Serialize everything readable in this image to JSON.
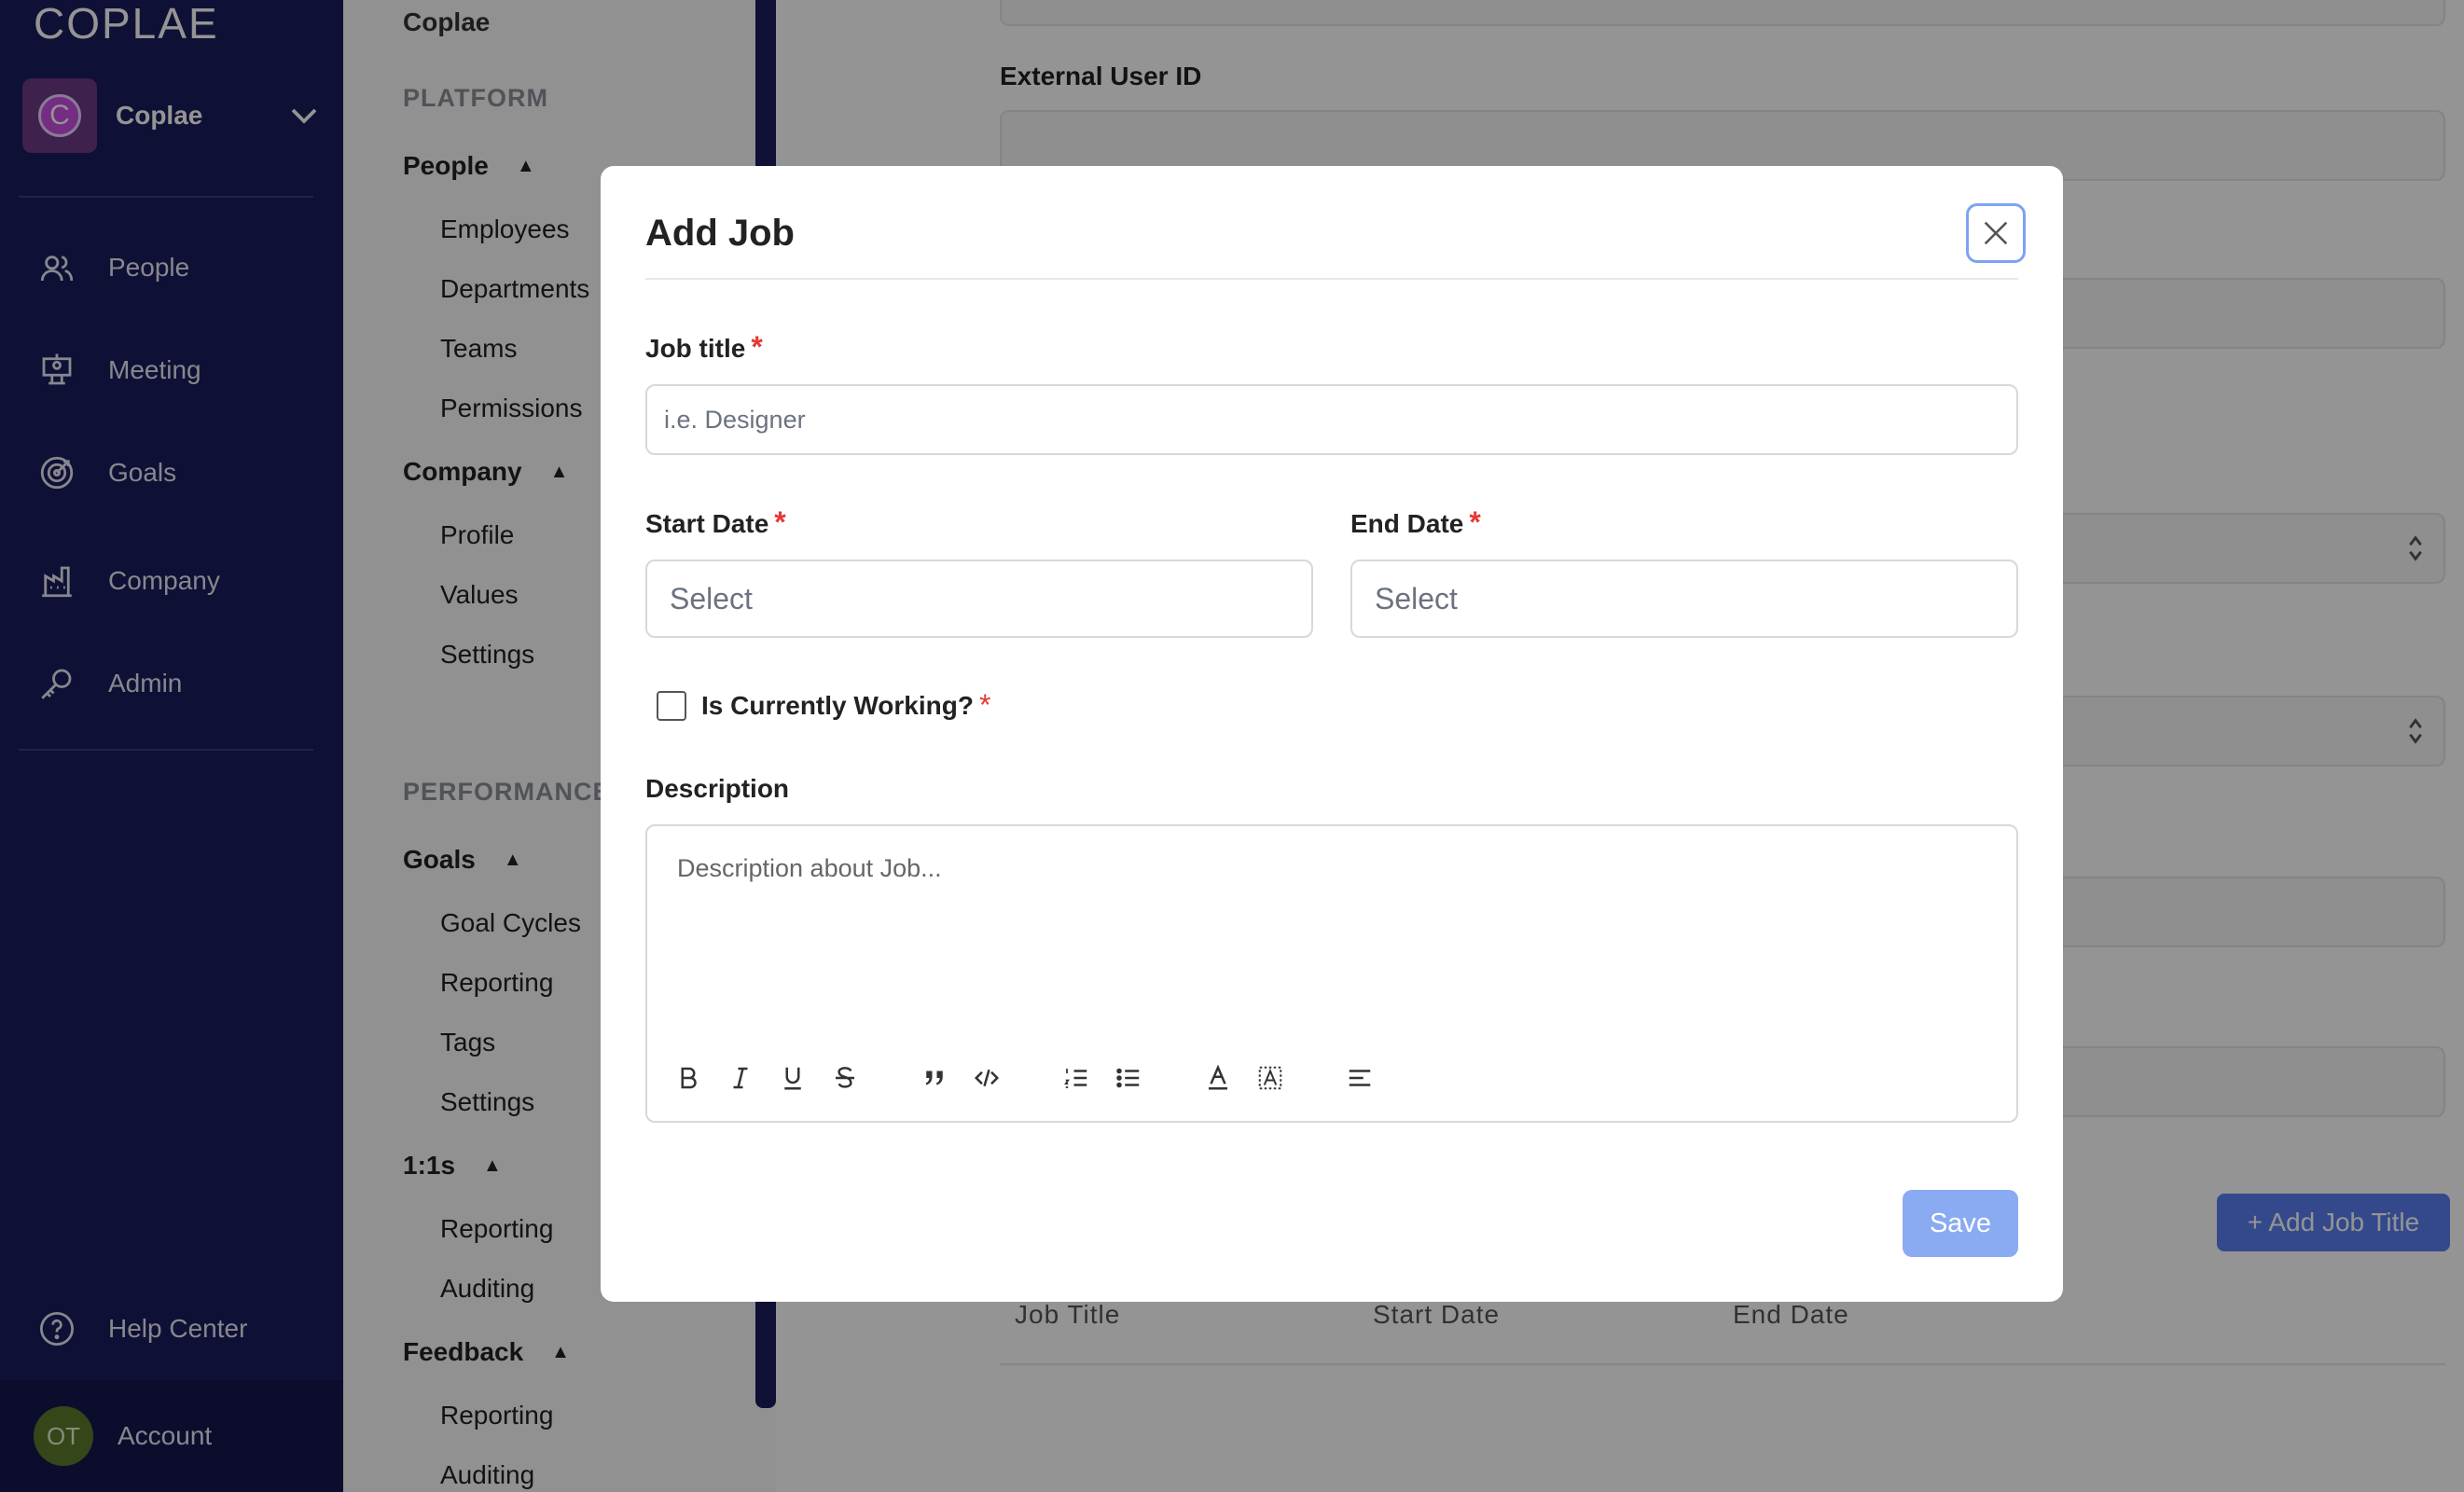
{
  "sidebar": {
    "logo": "COPLAE",
    "org": {
      "initial": "C",
      "name": "Coplae"
    },
    "nav": [
      {
        "label": "People",
        "icon": "people-icon"
      },
      {
        "label": "Meeting",
        "icon": "meeting-icon"
      },
      {
        "label": "Goals",
        "icon": "goals-icon"
      },
      {
        "label": "Company",
        "icon": "company-icon"
      },
      {
        "label": "Admin",
        "icon": "admin-key-icon"
      }
    ],
    "help_label": "Help Center",
    "account": {
      "initials": "OT",
      "label": "Account"
    }
  },
  "submenu": {
    "org_label": "Coplae",
    "platform_heading": "PLATFORM",
    "people_group": "People",
    "people_items": [
      "Employees",
      "Departments",
      "Teams",
      "Permissions"
    ],
    "company_group": "Company",
    "company_items": [
      "Profile",
      "Values",
      "Settings"
    ],
    "performance_heading": "PERFORMANCE",
    "goals_group": "Goals",
    "goals_items": [
      "Goal Cycles",
      "Reporting",
      "Tags",
      "Settings"
    ],
    "one_on_one_group": "1:1s",
    "one_on_one_items": [
      "Reporting",
      "Auditing"
    ],
    "feedback_group": "Feedback",
    "feedback_items": [
      "Reporting",
      "Auditing"
    ],
    "collapse_glyph": "▲"
  },
  "main": {
    "external_user_id_label": "External User ID",
    "add_job_title_button": "+ Add Job Title",
    "table_columns": [
      "Job Title",
      "Start Date",
      "End Date"
    ]
  },
  "modal": {
    "title": "Add Job",
    "job_title_label": "Job title",
    "job_title_placeholder": "i.e. Designer",
    "start_date_label": "Start Date",
    "start_date_placeholder": "Select",
    "end_date_label": "End Date",
    "end_date_placeholder": "Select",
    "currently_working_label": "Is Currently Working?",
    "currently_working_checked": false,
    "description_label": "Description",
    "description_placeholder": "Description about Job...",
    "required_mark": "*",
    "save_label": "Save",
    "toolbar": [
      "bold",
      "italic",
      "underline",
      "strikethrough",
      "blockquote",
      "code",
      "ordered-list",
      "bullet-list",
      "font-color",
      "highlight",
      "align"
    ]
  },
  "colors": {
    "sidebar_bg": "#1a1c5c",
    "primary": "#5b7ff0",
    "required": "#e53935"
  }
}
